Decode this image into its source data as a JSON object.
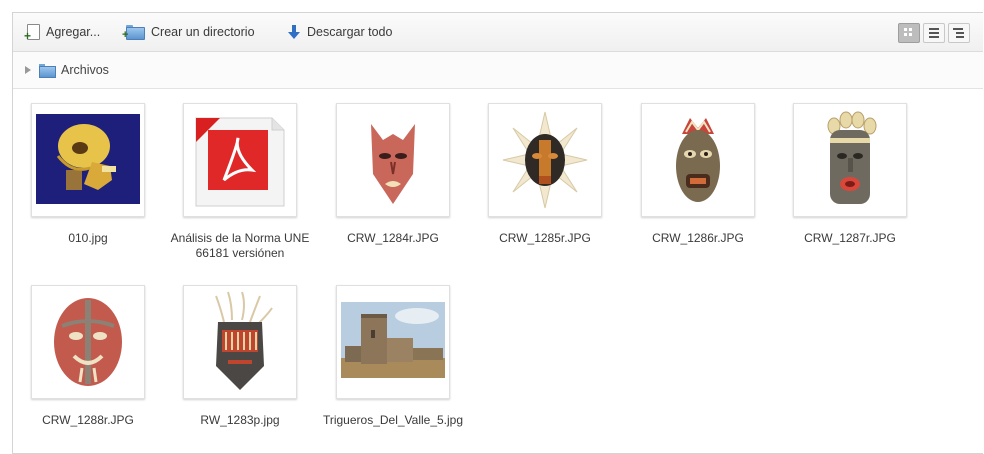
{
  "toolbar": {
    "add_label": "Agregar...",
    "mkdir_label": "Crear un directorio",
    "download_label": "Descargar todo"
  },
  "view_modes": [
    "icons",
    "list",
    "tree"
  ],
  "breadcrumb": {
    "label": "Archivos"
  },
  "files": [
    {
      "name": "010.jpg",
      "thumb": "skull-xray-image"
    },
    {
      "name": "Análisis de la Norma UNE 66181 versiónen",
      "thumb": "pdf-document-icon"
    },
    {
      "name": "CRW_1284r.JPG",
      "thumb": "mask-image"
    },
    {
      "name": "CRW_1285r.JPG",
      "thumb": "mask-image"
    },
    {
      "name": "CRW_1286r.JPG",
      "thumb": "mask-image"
    },
    {
      "name": "CRW_1287r.JPG",
      "thumb": "mask-image"
    },
    {
      "name": "CRW_1288r.JPG",
      "thumb": "mask-image"
    },
    {
      "name": "RW_1283p.jpg",
      "thumb": "mask-image"
    },
    {
      "name": "Trigueros_Del_Valle_5.jpg",
      "thumb": "castle-photo"
    }
  ]
}
